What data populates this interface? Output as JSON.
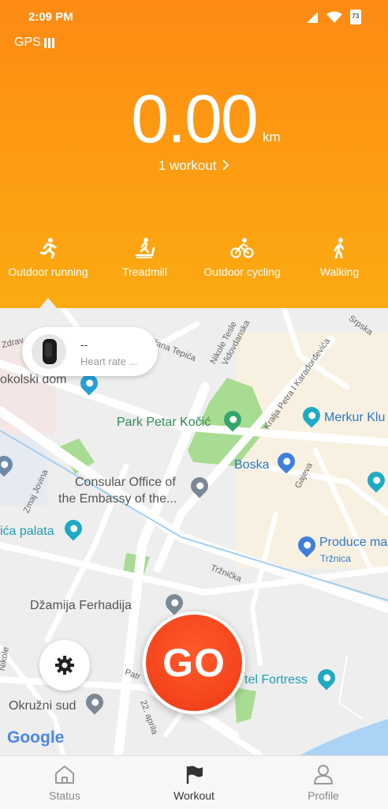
{
  "status_bar": {
    "time": "2:09 PM",
    "battery": "73"
  },
  "gps": {
    "label": "GPS"
  },
  "summary": {
    "distance": "0.00",
    "unit": "km",
    "workouts_link": "1 workout"
  },
  "modes": [
    {
      "label": "Outdoor running",
      "icon": "running-icon"
    },
    {
      "label": "Treadmill",
      "icon": "treadmill-icon"
    },
    {
      "label": "Outdoor cycling",
      "icon": "cycling-icon"
    },
    {
      "label": "Walking",
      "icon": "walking-icon"
    }
  ],
  "heart_rate": {
    "value": "--",
    "label": "Heart rate ..."
  },
  "map": {
    "labels": {
      "sokolski_dom": "okolski dom",
      "park": "Park Petar Kočić",
      "merkur": "Merkur Klu",
      "boska": "Boska",
      "consular_1": "Consular Office of",
      "consular_2": "the Embassy of the...",
      "palata": "ića palata",
      "produce": "Produce ma",
      "trznica": "Tržnica",
      "dzamija": "Džamija Ferhadija",
      "fortress": "tel Fortress",
      "okruzni": "Okružni sud"
    },
    "streets": {
      "zdrav": "Zdrav",
      "milana": "Milana Tepića",
      "nikole_tesle": "Nikole Tesle",
      "vidovdanska": "Vidovdanska",
      "srpska": "Srpska",
      "kralja": "Kralja Petra I Karađorđevića",
      "zmaj": "Zmaj Jovina",
      "gajeva": "Gajeva",
      "trznicka": "Tržnička",
      "patr": "Patr",
      "aprila": "22. aprila",
      "nikole_left": "Nikole"
    },
    "attribution": "Google"
  },
  "go_button": {
    "label": "GO"
  },
  "tabs": [
    {
      "label": "Status",
      "icon": "home-icon",
      "active": false
    },
    {
      "label": "Workout",
      "icon": "flag-icon",
      "active": true
    },
    {
      "label": "Profile",
      "icon": "person-icon",
      "active": false
    }
  ],
  "colors": {
    "accent": "#fd9412",
    "go": "#f4431c",
    "park": "#a8dc92"
  }
}
